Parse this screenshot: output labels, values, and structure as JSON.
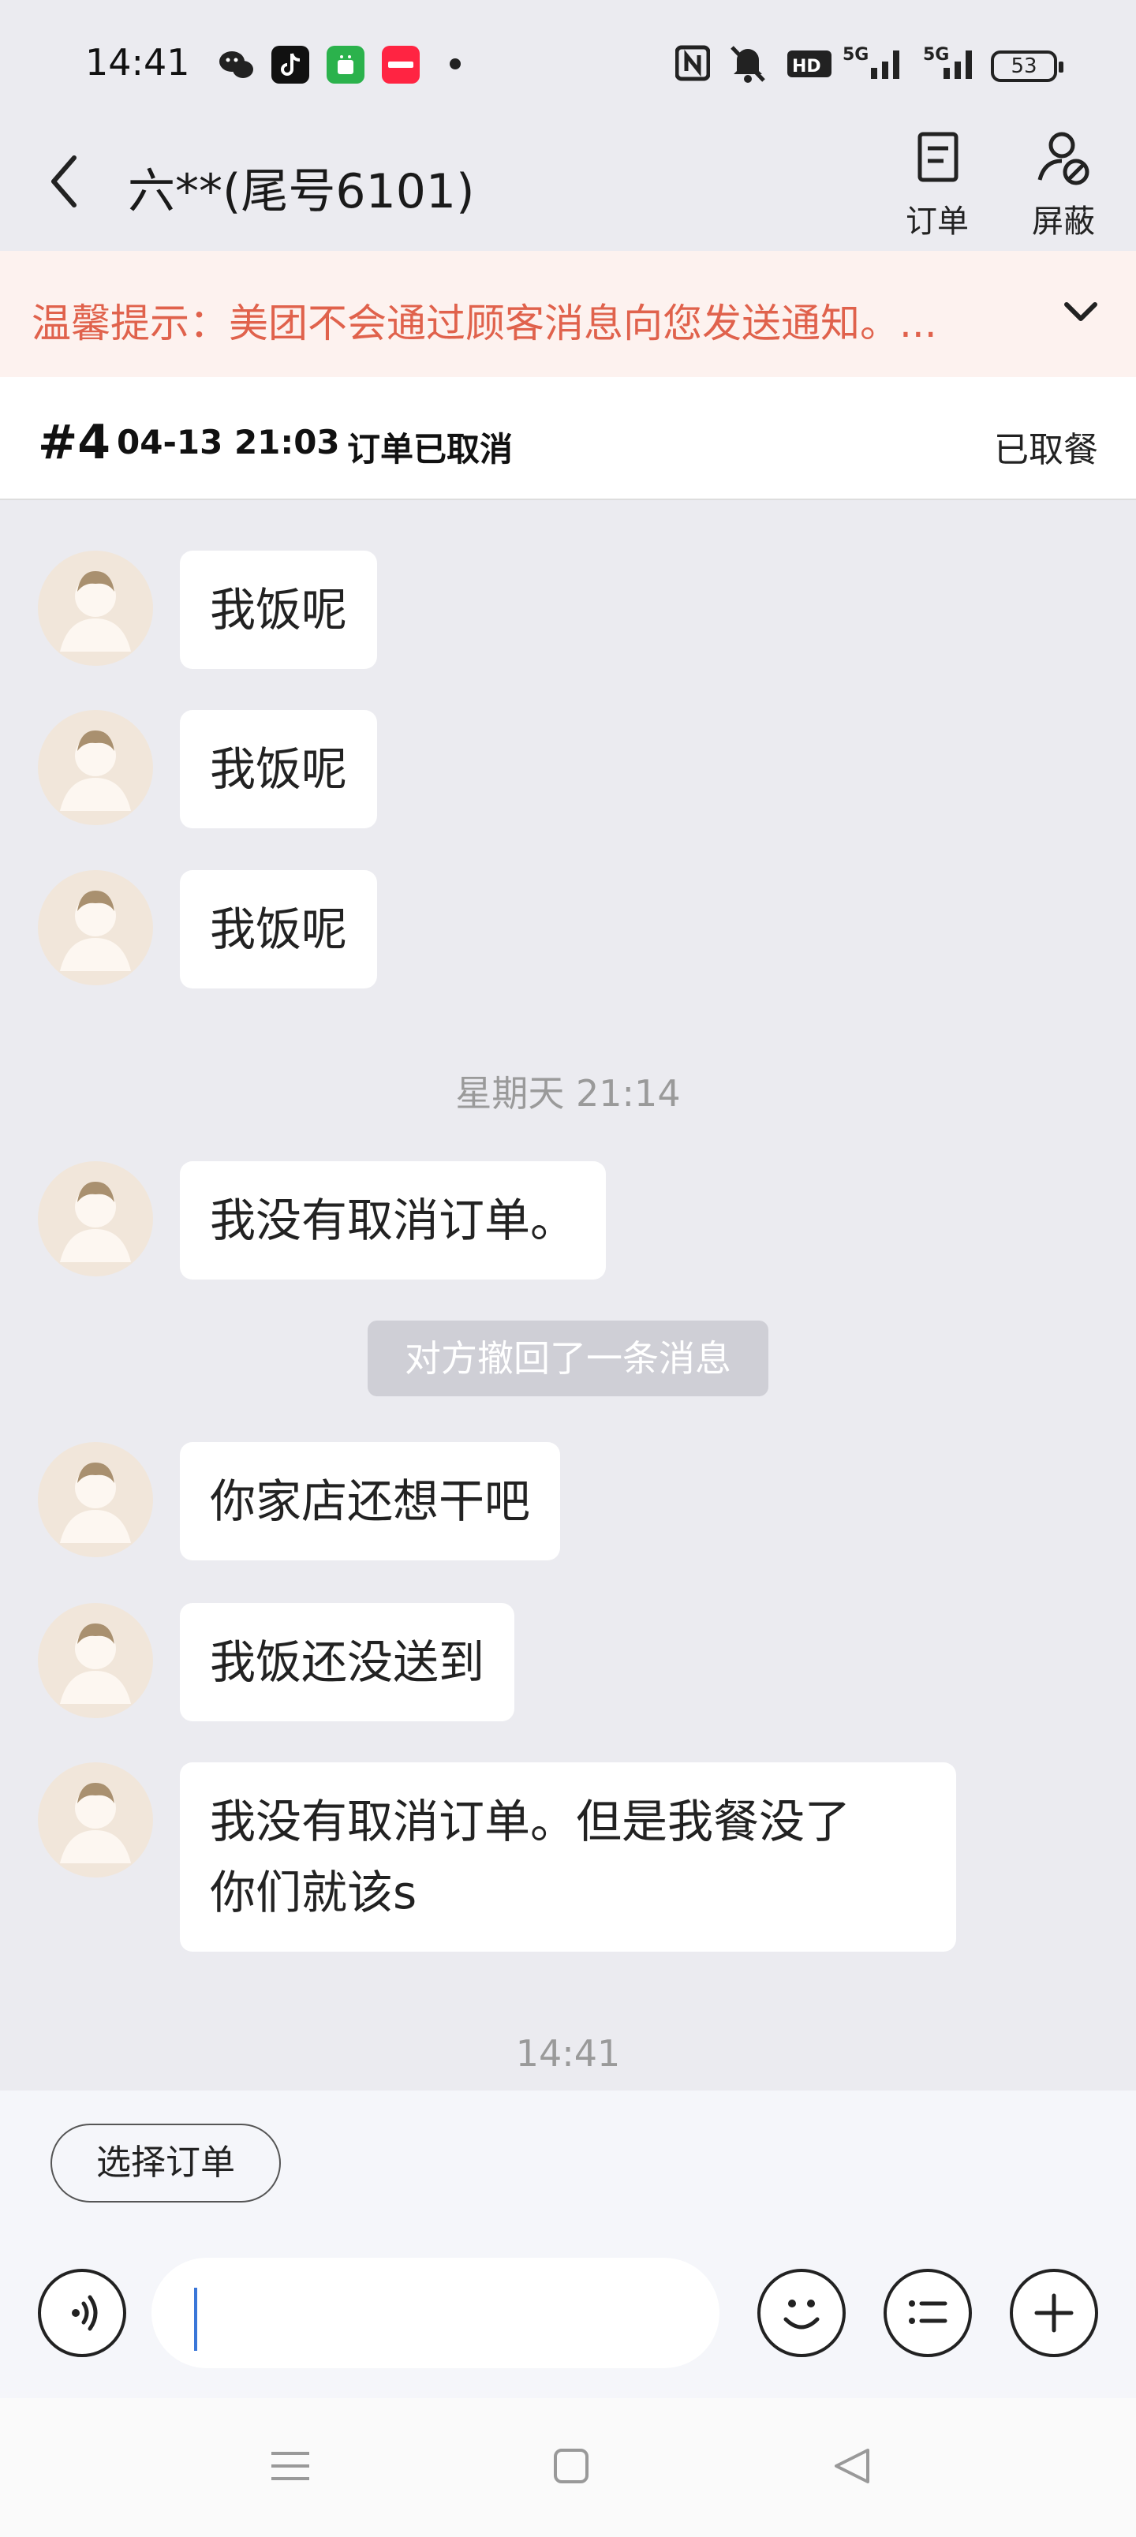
{
  "status_bar": {
    "time": "14:41",
    "battery": "53",
    "app_icons": [
      "wechat-icon",
      "douyin-icon",
      "android-app-icon",
      "xiaohongshu-icon"
    ],
    "right_icons": [
      "nfc-icon",
      "mute-icon",
      "hd-icon",
      "signal-5g-icon",
      "signal-5g-icon",
      "battery-icon"
    ]
  },
  "header": {
    "title": "六**(尾号6101)",
    "order_btn_label": "订单",
    "block_btn_label": "屏蔽"
  },
  "notice": {
    "text": "温馨提示：美团不会通过顾客消息向您发送通知。..."
  },
  "order": {
    "number": "#4",
    "datetime": "04-13 21:03",
    "status": "订单已取消",
    "pickup": "已取餐"
  },
  "messages": [
    {
      "text": "我饭呢"
    },
    {
      "text": "我饭呢"
    },
    {
      "text": "我饭呢"
    },
    {
      "text": "我没有取消订单。"
    },
    {
      "text": "你家店还想干吧"
    },
    {
      "text": "我饭还没送到"
    },
    {
      "text_line1": "我没有取消订单。但是我餐没了",
      "text_line2": "你们就该s"
    }
  ],
  "time_labels": [
    "星期天 21:14",
    "14:41"
  ],
  "recall_notice": "对方撤回了一条消息",
  "bottom": {
    "choose_order_label": "选择订单",
    "input_value": ""
  },
  "colors": {
    "notice_text": "#e0624c",
    "notice_bg": "#fdf2ef",
    "chat_bg": "#ebebf0",
    "caret": "#3a76d8"
  }
}
